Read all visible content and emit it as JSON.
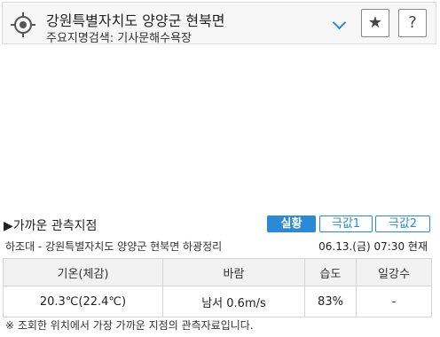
{
  "location": {
    "title": "강원특별자치도 양양군 현북면",
    "sub_label": "주요지명검색: 기사문해수욕장"
  },
  "buttons": {
    "favorite_icon": "★",
    "help_icon": "?"
  },
  "section": {
    "title": "▶가까운 관측지점"
  },
  "tabs": [
    {
      "label": "실황",
      "active": true
    },
    {
      "label": "극값1",
      "active": false
    },
    {
      "label": "극값2",
      "active": false
    }
  ],
  "station": {
    "name": "하조대 - 강원특별자치도 양양군 현북면 하광정리",
    "time": "06.13.(금) 07:30 현재"
  },
  "table": {
    "headers": [
      "기온(체감)",
      "바람",
      "습도",
      "일강수"
    ],
    "row": [
      "20.3℃(22.4℃)",
      "남서 0.6m/s",
      "83%",
      "-"
    ]
  },
  "footnote": "※ 조회한 위치에서 가장 가까운 지점의 관측자료입니다.",
  "colors": {
    "accent": "#2b8ad7",
    "header_bg": "#f2f2f2",
    "bar_bg": "#f7f7f7"
  }
}
